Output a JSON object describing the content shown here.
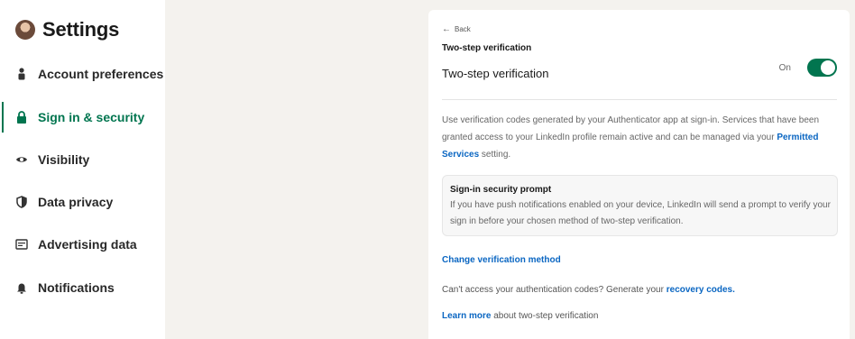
{
  "sidebar": {
    "title": "Settings",
    "items": [
      {
        "label": "Account preferences",
        "icon": "person-icon",
        "active": false
      },
      {
        "label": "Sign in & security",
        "icon": "lock-icon",
        "active": true
      },
      {
        "label": "Visibility",
        "icon": "eye-icon",
        "active": false
      },
      {
        "label": "Data privacy",
        "icon": "shield-icon",
        "active": false
      },
      {
        "label": "Advertising data",
        "icon": "ad-card-icon",
        "active": false
      },
      {
        "label": "Notifications",
        "icon": "bell-icon",
        "active": false
      }
    ]
  },
  "main": {
    "back_label": "Back",
    "small_title": "Two-step verification",
    "row_title": "Two-step verification",
    "toggle_state_label": "On",
    "description": {
      "text_before": "Use verification codes generated by your Authenticator app at sign-in. Services that have been granted access to your LinkedIn profile remain active and can be managed via your ",
      "link": "Permitted Services",
      "text_after": " setting."
    },
    "prompt": {
      "title": "Sign-in security prompt",
      "text": "If you have push notifications enabled on your device, LinkedIn will send a prompt to verify your sign in before your chosen method of two-step verification."
    },
    "change_method_link": "Change verification method",
    "recovery": {
      "text": "Can't access your authentication codes? Generate your ",
      "link": "recovery codes."
    },
    "learn_more": {
      "link": "Learn more",
      "text": " about two-step verification"
    }
  },
  "colors": {
    "accent_green": "#01754f",
    "link_blue": "#0a66c2",
    "page_bg": "#f4f2ee"
  }
}
